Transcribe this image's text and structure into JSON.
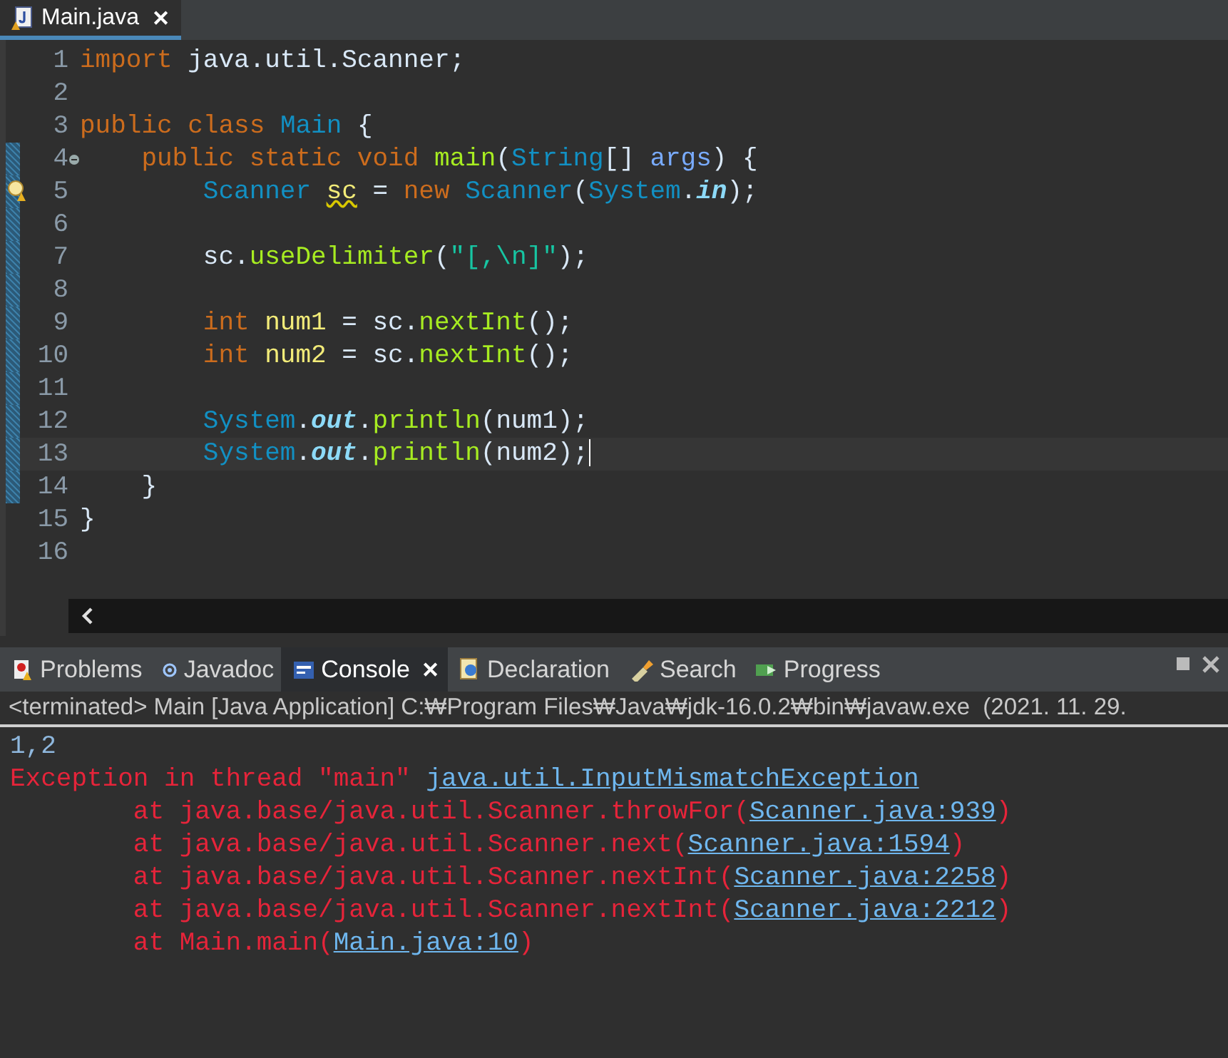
{
  "editor_tab": {
    "label": "Main.java",
    "close": "✕",
    "selected": true
  },
  "editor": {
    "lines": [
      {
        "number": "1",
        "tokens": [
          {
            "text": "import",
            "kind": "keyword"
          },
          {
            "text": " java.util.Scanner;",
            "kind": "plain"
          }
        ]
      },
      {
        "number": "2"
      },
      {
        "number": "3",
        "tokens": [
          {
            "text": "public class ",
            "kind": "keyword"
          },
          {
            "text": "Main",
            "kind": "type"
          },
          {
            "text": " {",
            "kind": "plain"
          }
        ]
      },
      {
        "number": "4",
        "folding": true,
        "range": true,
        "tokens": [
          {
            "text": "    public static void ",
            "kind": "keyword"
          },
          {
            "text": "main",
            "kind": "method"
          },
          {
            "text": "(",
            "kind": "plain"
          },
          {
            "text": "String",
            "kind": "type"
          },
          {
            "text": "[] ",
            "kind": "plain"
          },
          {
            "text": "args",
            "kind": "param"
          },
          {
            "text": ") {",
            "kind": "plain"
          }
        ]
      },
      {
        "number": "5",
        "warning": true,
        "range": true,
        "tokens": [
          {
            "text": "        Scanner ",
            "kind": "type"
          },
          {
            "text": "sc",
            "kind": "warnvar"
          },
          {
            "text": " = ",
            "kind": "plain"
          },
          {
            "text": "new ",
            "kind": "keyword"
          },
          {
            "text": "Scanner",
            "kind": "type"
          },
          {
            "text": "(",
            "kind": "plain"
          },
          {
            "text": "System",
            "kind": "type"
          },
          {
            "text": ".",
            "kind": "plain"
          },
          {
            "text": "in",
            "kind": "field"
          },
          {
            "text": ");",
            "kind": "plain"
          }
        ]
      },
      {
        "number": "6",
        "range": true
      },
      {
        "number": "7",
        "range": true,
        "tokens": [
          {
            "text": "        sc.",
            "kind": "plain"
          },
          {
            "text": "useDelimiter",
            "kind": "method"
          },
          {
            "text": "(",
            "kind": "plain"
          },
          {
            "text": "\"[,\\n]\"",
            "kind": "string"
          },
          {
            "text": ");",
            "kind": "plain"
          }
        ]
      },
      {
        "number": "8",
        "range": true
      },
      {
        "number": "9",
        "range": true,
        "tokens": [
          {
            "text": "        int ",
            "kind": "keyword"
          },
          {
            "text": "num1",
            "kind": "local"
          },
          {
            "text": " = sc.",
            "kind": "plain"
          },
          {
            "text": "nextInt",
            "kind": "method"
          },
          {
            "text": "();",
            "kind": "plain"
          }
        ]
      },
      {
        "number": "10",
        "range": true,
        "tokens": [
          {
            "text": "        int ",
            "kind": "keyword"
          },
          {
            "text": "num2",
            "kind": "local"
          },
          {
            "text": " = sc.",
            "kind": "plain"
          },
          {
            "text": "nextInt",
            "kind": "method"
          },
          {
            "text": "();",
            "kind": "plain"
          }
        ]
      },
      {
        "number": "11",
        "range": true
      },
      {
        "number": "12",
        "range": true,
        "tokens": [
          {
            "text": "        System",
            "kind": "type"
          },
          {
            "text": ".",
            "kind": "plain"
          },
          {
            "text": "out",
            "kind": "field"
          },
          {
            "text": ".",
            "kind": "plain"
          },
          {
            "text": "println",
            "kind": "method"
          },
          {
            "text": "(num1);",
            "kind": "plain"
          }
        ]
      },
      {
        "number": "13",
        "range": true,
        "current": true,
        "tokens": [
          {
            "text": "        System",
            "kind": "type"
          },
          {
            "text": ".",
            "kind": "plain"
          },
          {
            "text": "out",
            "kind": "field"
          },
          {
            "text": ".",
            "kind": "plain"
          },
          {
            "text": "println",
            "kind": "method"
          },
          {
            "text": "(num2);",
            "kind": "plain"
          }
        ]
      },
      {
        "number": "14",
        "range": true,
        "tokens": [
          {
            "text": "    }",
            "kind": "plain"
          }
        ]
      },
      {
        "number": "15",
        "tokens": [
          {
            "text": "}",
            "kind": "plain"
          }
        ]
      },
      {
        "number": "16"
      }
    ]
  },
  "view_tabs": [
    {
      "label": "Problems",
      "selected": false
    },
    {
      "label": "Javadoc",
      "selected": false
    },
    {
      "label": "Console",
      "close": "✕",
      "selected": true
    },
    {
      "label": "Declaration",
      "selected": false
    },
    {
      "label": "Search",
      "selected": false
    },
    {
      "label": "Progress",
      "selected": false
    }
  ],
  "console": {
    "header": "<terminated> Main [Java Application] C:₩Program Files₩Java₩jdk-16.0.2₩bin₩javaw.exe  (2021. 11. 29.",
    "lines": [
      [
        {
          "text": "1,2",
          "kind": "input"
        }
      ],
      [
        {
          "text": "Exception in thread \"main\" ",
          "kind": "error"
        },
        {
          "text": "java.util.InputMismatchException",
          "kind": "link"
        }
      ],
      [
        {
          "text": "        at java.base/java.util.Scanner.throwFor(",
          "kind": "error"
        },
        {
          "text": "Scanner.java:939",
          "kind": "link"
        },
        {
          "text": ")",
          "kind": "error"
        }
      ],
      [
        {
          "text": "        at java.base/java.util.Scanner.next(",
          "kind": "error"
        },
        {
          "text": "Scanner.java:1594",
          "kind": "link"
        },
        {
          "text": ")",
          "kind": "error"
        }
      ],
      [
        {
          "text": "        at java.base/java.util.Scanner.nextInt(",
          "kind": "error"
        },
        {
          "text": "Scanner.java:2258",
          "kind": "link"
        },
        {
          "text": ")",
          "kind": "error"
        }
      ],
      [
        {
          "text": "        at java.base/java.util.Scanner.nextInt(",
          "kind": "error"
        },
        {
          "text": "Scanner.java:2212",
          "kind": "link"
        },
        {
          "text": ")",
          "kind": "error"
        }
      ],
      [
        {
          "text": "        at Main.main(",
          "kind": "error"
        },
        {
          "text": "Main.java:10",
          "kind": "link"
        },
        {
          "text": ")",
          "kind": "error"
        }
      ]
    ]
  }
}
